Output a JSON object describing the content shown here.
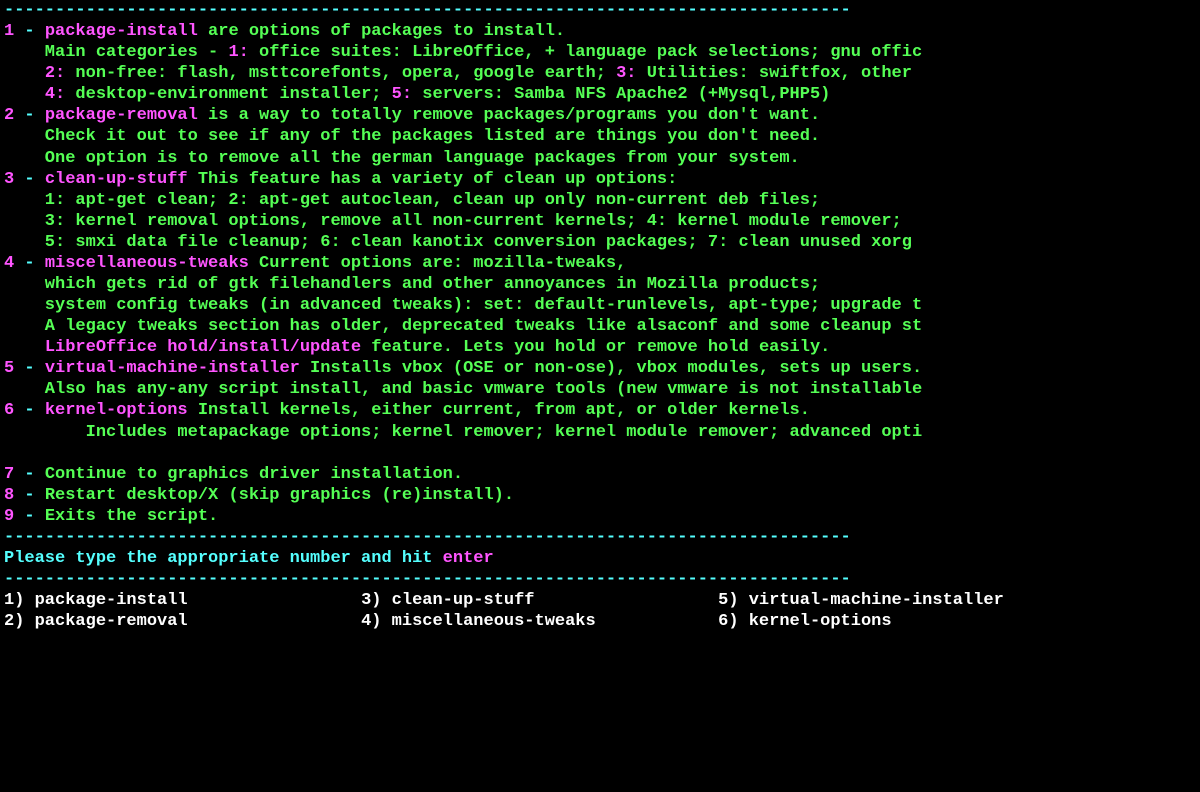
{
  "colors": {
    "magenta": "#ff55ff",
    "green": "#55ff55",
    "cyan": "#55ffff",
    "white": "#ffffff",
    "bg": "#000000"
  },
  "divider_top": "-----------------------------------------------------------------------------------",
  "divider_mid": "-----------------------------------------------------------------------------------",
  "divider_bot": "-----------------------------------------------------------------------------------",
  "prompt_prefix": "Please type the appropriate number and hit ",
  "prompt_enter": "enter",
  "menu": [
    {
      "num": "1",
      "title": "package-install",
      "tail": " are options of packages to install.",
      "body": [
        [
          {
            "cls": "g",
            "txt": "    Main categories - "
          },
          {
            "cls": "m",
            "txt": "1:"
          },
          {
            "cls": "g",
            "txt": " office suites: LibreOffice, + language pack selections; gnu offic"
          }
        ],
        [
          {
            "cls": "g",
            "txt": "    "
          },
          {
            "cls": "m",
            "txt": "2:"
          },
          {
            "cls": "g",
            "txt": " non-free: flash, msttcorefonts, opera, google earth; "
          },
          {
            "cls": "m",
            "txt": "3:"
          },
          {
            "cls": "g",
            "txt": " Utilities: swiftfox, other"
          }
        ],
        [
          {
            "cls": "g",
            "txt": "    "
          },
          {
            "cls": "m",
            "txt": "4:"
          },
          {
            "cls": "g",
            "txt": " desktop-environment installer; "
          },
          {
            "cls": "m",
            "txt": "5:"
          },
          {
            "cls": "g",
            "txt": " servers: Samba NFS Apache2 (+Mysql,PHP5)"
          }
        ]
      ]
    },
    {
      "num": "2",
      "title": "package-removal",
      "tail": " is a way to totally remove packages/programs you don't want.",
      "body": [
        [
          {
            "cls": "g",
            "txt": "    Check it out to see if any of the packages listed are things you don't need."
          }
        ],
        [
          {
            "cls": "g",
            "txt": "    One option is to remove all the german language packages from your system."
          }
        ]
      ]
    },
    {
      "num": "3",
      "title": "clean-up-stuff",
      "tail": " This feature has a variety of clean up options:",
      "body": [
        [
          {
            "cls": "g",
            "txt": "    1: apt-get clean; 2: apt-get autoclean, clean up only non-current deb files;"
          }
        ],
        [
          {
            "cls": "g",
            "txt": "    3: kernel removal options, remove all non-current kernels; 4: kernel module remover;"
          }
        ],
        [
          {
            "cls": "g",
            "txt": "    5: smxi data file cleanup; 6: clean kanotix conversion packages; 7: clean unused xorg"
          }
        ]
      ]
    },
    {
      "num": "4",
      "title": "miscellaneous-tweaks",
      "tail": " Current options are: mozilla-tweaks,",
      "body": [
        [
          {
            "cls": "g",
            "txt": "    which gets rid of gtk filehandlers and other annoyances in Mozilla products;"
          }
        ],
        [
          {
            "cls": "g",
            "txt": "    system config tweaks (in advanced tweaks): set: default-runlevels, apt-type; upgrade t"
          }
        ],
        [
          {
            "cls": "g",
            "txt": "    A legacy tweaks section has older, deprecated tweaks like alsaconf and some cleanup st"
          }
        ],
        [
          {
            "cls": "g",
            "txt": "    "
          },
          {
            "cls": "m",
            "txt": "LibreOffice hold/install/update"
          },
          {
            "cls": "g",
            "txt": " feature. Lets you hold or remove hold easily."
          }
        ]
      ]
    },
    {
      "num": "5",
      "title": "virtual-machine-installer",
      "tail": " Installs vbox (OSE or non-ose), vbox modules, sets up users.",
      "body": [
        [
          {
            "cls": "g",
            "txt": "    Also has any-any script install, and basic vmware tools (new vmware is not installable"
          }
        ]
      ]
    },
    {
      "num": "6",
      "title": "kernel-options",
      "tail": " Install kernels, either current, from apt, or older kernels.",
      "body": [
        [
          {
            "cls": "g",
            "txt": "        Includes metapackage options; kernel remover; kernel module remover; advanced opti"
          }
        ],
        [
          {
            "cls": "g",
            "txt": " "
          }
        ]
      ]
    },
    {
      "num": "7",
      "title": "",
      "tail": "Continue to graphics driver installation.",
      "body": []
    },
    {
      "num": "8",
      "title": "",
      "tail": "Restart desktop/X (skip graphics (re)install).",
      "body": []
    },
    {
      "num": "9",
      "title": "",
      "tail": "Exits the script.",
      "body": []
    }
  ],
  "choices_row1": {
    "c1_num": "1) ",
    "c1_txt": "package-install",
    "c3_num": "3) ",
    "c3_txt": "clean-up-stuff",
    "c5_num": "5) ",
    "c5_txt": "virtual-machine-installer"
  },
  "choices_row2": {
    "c2_num": "2) ",
    "c2_txt": "package-removal",
    "c4_num": "4) ",
    "c4_txt": "miscellaneous-tweaks",
    "c6_num": "6) ",
    "c6_txt": "kernel-options"
  },
  "col_positions": {
    "a": 0,
    "b": 35,
    "c": 70
  }
}
